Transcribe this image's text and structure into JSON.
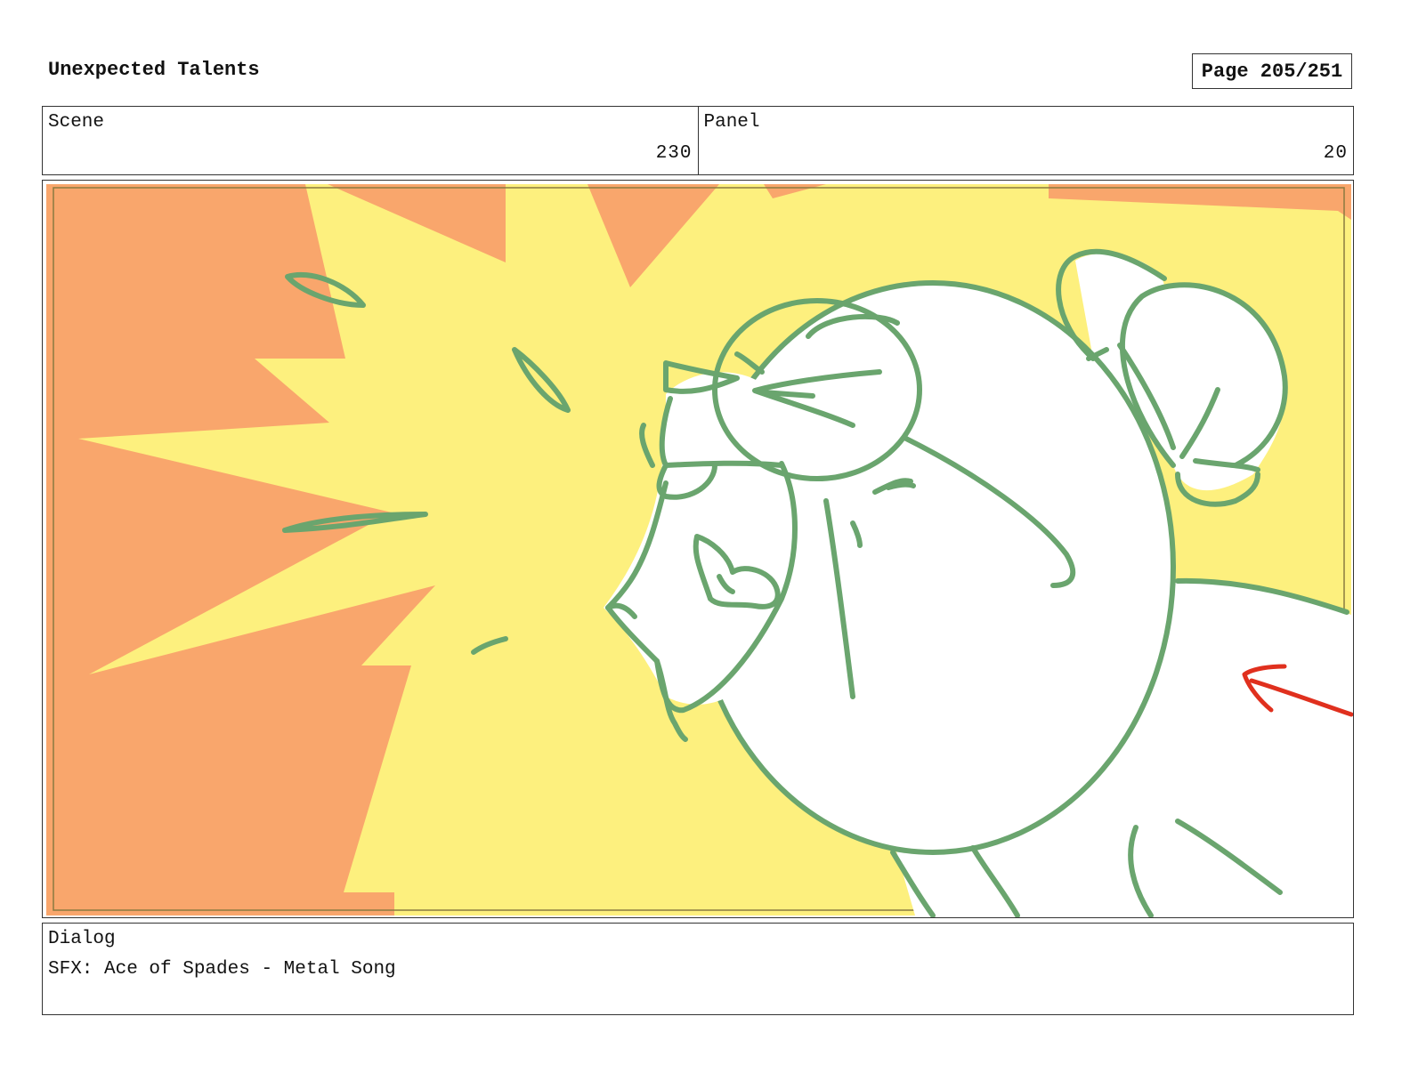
{
  "header": {
    "title": "Unexpected Talents",
    "page_label": "Page 205/251"
  },
  "info": {
    "scene_label": "Scene",
    "scene_value": "230",
    "panel_label": "Panel",
    "panel_value": "20"
  },
  "dialog": {
    "label": "Dialog",
    "text": "SFX: Ace of Spades - Metal Song"
  },
  "colors": {
    "background_orange": "#f9a66c",
    "burst_yellow": "#fdf07e",
    "line_green": "#6aa56e",
    "arrow_red": "#e0301e"
  }
}
